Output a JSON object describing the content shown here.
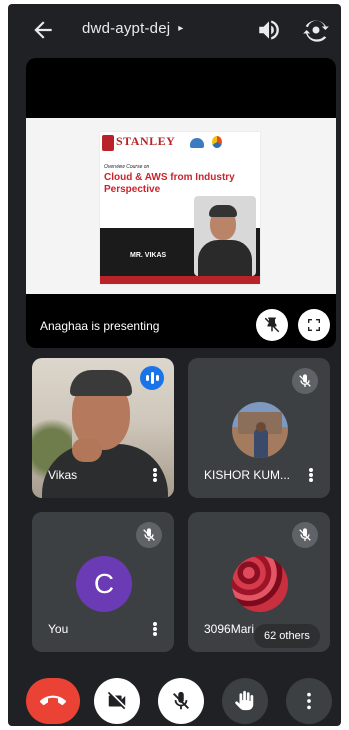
{
  "topbar": {
    "back_icon": "arrow-left-icon",
    "meeting_code": "dwd-aypt-dej",
    "caret": "▸",
    "speaker_icon": "speaker-icon",
    "switch_camera_icon": "switch-camera-icon"
  },
  "presentation": {
    "presenter_label": "Anaghaa is presenting",
    "slide": {
      "brand": "STANLEY",
      "overview_text": "Overview Course on",
      "course_title": "Cloud & AWS from Industry Perspective",
      "speaker_name": "MR. VIKAS"
    },
    "pin_icon": "unpin-icon",
    "fullscreen_icon": "fullscreen-icon"
  },
  "participants": [
    {
      "name": "Vikas",
      "status": "speaking"
    },
    {
      "name": "KISHOR KUM...",
      "status": "muted"
    },
    {
      "name": "You",
      "initial": "C",
      "status": "muted"
    },
    {
      "name": "3096Mari",
      "status": "muted"
    }
  ],
  "others_count_label": "62 others",
  "controls": {
    "end_call_icon": "end-call-icon",
    "camera_icon": "camera-off-icon",
    "mic_icon": "mic-off-icon",
    "hand_icon": "raise-hand-icon",
    "more_icon": "more-options-icon"
  },
  "colors": {
    "background": "#202124",
    "tile": "#3c4043",
    "end_call": "#ea4335",
    "speaking": "#1a73e8",
    "avatar_you": "#6a3bb5"
  }
}
